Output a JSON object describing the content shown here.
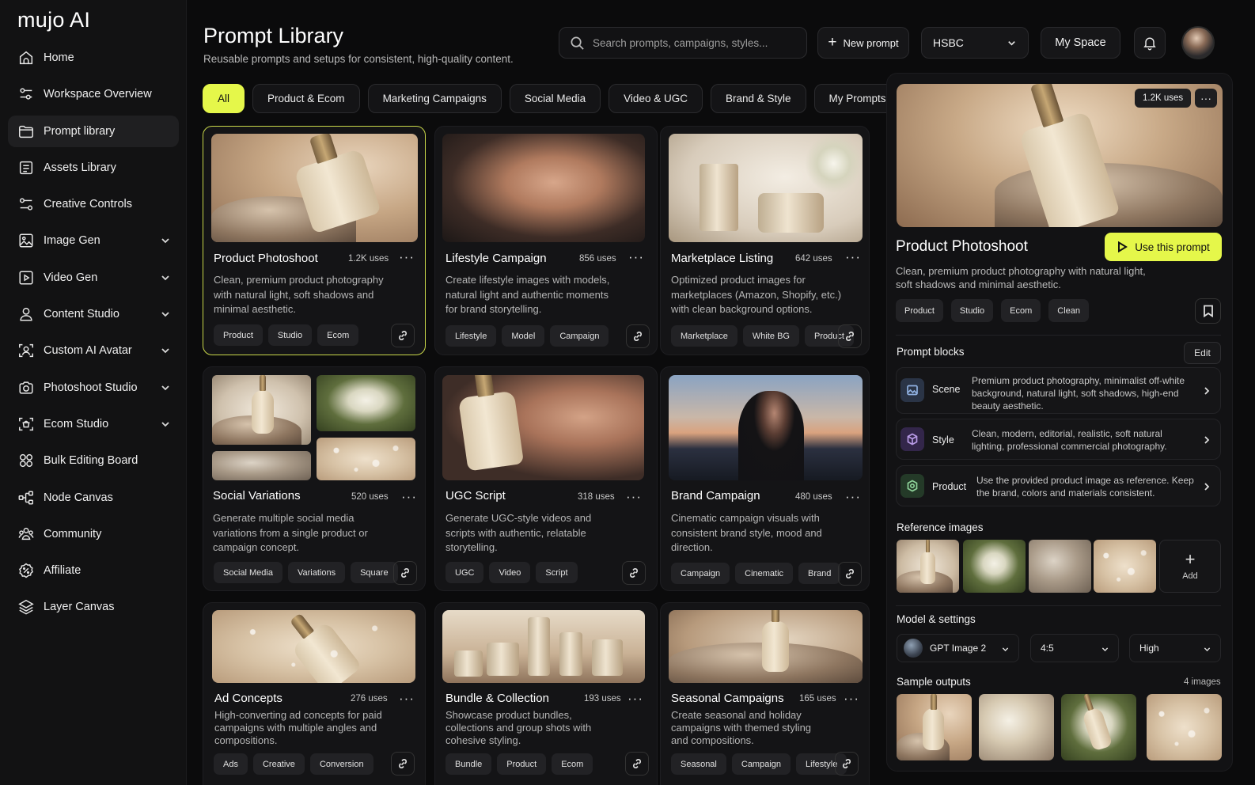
{
  "app": {
    "logo": "mujo AI"
  },
  "sidebar": {
    "items": [
      {
        "label": "Home",
        "icon": "home-icon"
      },
      {
        "label": "Workspace Overview",
        "icon": "sliders-icon"
      },
      {
        "label": "Prompt library",
        "icon": "folder-icon",
        "active": true
      },
      {
        "label": "Assets Library",
        "icon": "document-icon"
      },
      {
        "label": "Creative Controls",
        "icon": "controls-icon"
      },
      {
        "label": "Image Gen",
        "icon": "image-icon",
        "expandable": true
      },
      {
        "label": "Video Gen",
        "icon": "video-icon",
        "expandable": true
      },
      {
        "label": "Content Studio",
        "icon": "user-icon",
        "expandable": true
      },
      {
        "label": "Custom AI Avatar",
        "icon": "avatar-scan-icon",
        "expandable": true
      },
      {
        "label": "Photoshoot Studio",
        "icon": "camera-icon",
        "expandable": true
      },
      {
        "label": "Ecom Studio",
        "icon": "bag-scan-icon",
        "expandable": true
      },
      {
        "label": "Bulk Editing Board",
        "icon": "grid-icon"
      },
      {
        "label": "Node Canvas",
        "icon": "node-icon"
      },
      {
        "label": "Community",
        "icon": "community-icon"
      },
      {
        "label": "Affiliate",
        "icon": "badge-percent-icon"
      },
      {
        "label": "Layer Canvas",
        "icon": "layers-icon"
      }
    ]
  },
  "header": {
    "title": "Prompt Library",
    "subtitle": "Reusable prompts and setups for consistent, high-quality content.",
    "search_placeholder": "Search prompts, campaigns, styles...",
    "new_prompt_label": "New prompt",
    "workspace_select": "HSBC",
    "my_space_label": "My Space"
  },
  "filters": [
    "All",
    "Product & Ecom",
    "Marketing Campaigns",
    "Social Media",
    "Video & UGC",
    "Brand & Style",
    "My Prompts"
  ],
  "cards": [
    {
      "title": "Product Photoshoot",
      "uses": "1.2K uses",
      "desc": "Clean, premium product photography with natural light, soft shadows and minimal aesthetic.",
      "tags": [
        "Product",
        "Studio",
        "Ecom"
      ]
    },
    {
      "title": "Lifestyle Campaign",
      "uses": "856 uses",
      "desc": "Create lifestyle images with models, natural light and authentic moments for brand storytelling.",
      "tags": [
        "Lifestyle",
        "Model",
        "Campaign"
      ]
    },
    {
      "title": "Marketplace Listing",
      "uses": "642 uses",
      "desc": "Optimized product images for marketplaces (Amazon, Shopify, etc.) with clean background options.",
      "tags": [
        "Marketplace",
        "White BG",
        "Product"
      ]
    },
    {
      "title": "Social Variations",
      "uses": "520 uses",
      "desc": "Generate multiple social media variations from a single product or campaign concept.",
      "tags": [
        "Social Media",
        "Variations",
        "Square"
      ]
    },
    {
      "title": "UGC Script",
      "uses": "318 uses",
      "desc": "Generate UGC-style videos and scripts with authentic, relatable storytelling.",
      "tags": [
        "UGC",
        "Video",
        "Script"
      ]
    },
    {
      "title": "Brand Campaign",
      "uses": "480 uses",
      "desc": "Cinematic campaign visuals with consistent brand style, mood and direction.",
      "tags": [
        "Campaign",
        "Cinematic",
        "Brand"
      ]
    },
    {
      "title": "Ad Concepts",
      "uses": "276 uses",
      "desc": "High-converting ad concepts for paid campaigns with multiple angles and compositions.",
      "tags": [
        "Ads",
        "Creative",
        "Conversion"
      ]
    },
    {
      "title": "Bundle & Collection",
      "uses": "193 uses",
      "desc": "Showcase product bundles, collections and group shots with cohesive styling.",
      "tags": [
        "Bundle",
        "Product",
        "Ecom"
      ]
    },
    {
      "title": "Seasonal Campaigns",
      "uses": "165 uses",
      "desc": "Create seasonal and holiday campaigns with themed styling and compositions.",
      "tags": [
        "Seasonal",
        "Campaign",
        "Lifestyle"
      ]
    }
  ],
  "panel": {
    "uses": "1.2K uses",
    "title": "Product Photoshoot",
    "use_button": "Use this prompt",
    "desc": "Clean, premium product photography with natural light, soft shadows and minimal aesthetic.",
    "tags": [
      "Product",
      "Studio",
      "Ecom",
      "Clean"
    ],
    "blocks_title": "Prompt blocks",
    "edit_label": "Edit",
    "blocks": [
      {
        "name": "Scene",
        "text": "Premium product photography, minimalist off-white background, natural light, soft shadows, high-end beauty aesthetic.",
        "color": "#2a3446",
        "stroke": "#8fb0e0"
      },
      {
        "name": "Style",
        "text": "Clean, modern, editorial, realistic, soft natural lighting, professional commercial photography.",
        "color": "#33264a",
        "stroke": "#b89be6"
      },
      {
        "name": "Product",
        "text": "Use the provided product image as reference. Keep the brand, colors and materials consistent.",
        "color": "#243a28",
        "stroke": "#8fd39a"
      }
    ],
    "ref_title": "Reference images",
    "add_label": "Add",
    "model_title": "Model & settings",
    "model": "GPT Image 2",
    "ratio": "4:5",
    "quality": "High",
    "samples_title": "Sample outputs",
    "samples_count": "4 images"
  }
}
